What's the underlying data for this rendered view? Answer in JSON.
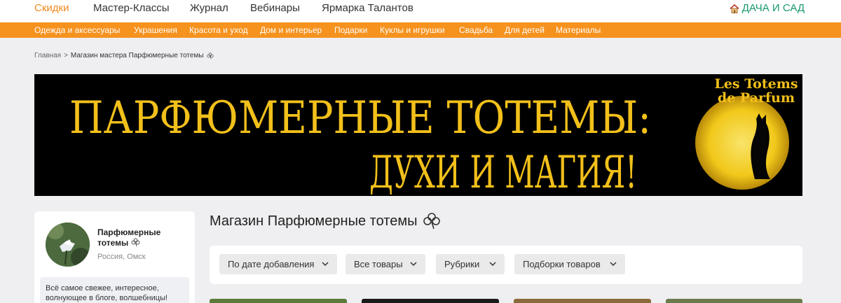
{
  "topnav": {
    "items": [
      "Скидки",
      "Мастер-Классы",
      "Журнал",
      "Вебинары",
      "Ярмарка Талантов"
    ],
    "right_link": "ДАЧА И САД",
    "active_color": "#f0891e",
    "right_color": "#1a9a6b"
  },
  "categories": [
    "Одежда и аксессуары",
    "Украшения",
    "Красота и уход",
    "Дом и интерьер",
    "Подарки",
    "Куклы и игрушки",
    "Свадьба",
    "Для детей",
    "Материалы"
  ],
  "breadcrumb": {
    "home": "Главная",
    "separator": ">",
    "current": "Магазин мастера Парфюмерные тотемы"
  },
  "banner": {
    "line1": "ПАРФЮМЕРНЫЕ ТОТЕМЫ:",
    "line2": "ДУХИ И МАГИЯ!",
    "logo_line1": "Les Totems",
    "logo_line2": "de Parfum"
  },
  "profile": {
    "name": "Парфюмерные тотемы",
    "location": "Россия, Омск",
    "bio": "Всё самое свежее, интересное, волнующее в блоге, волшебницы!"
  },
  "store": {
    "title": "Магазин Парфюмерные тотемы"
  },
  "filters": [
    "По дате добавления",
    "Все товары",
    "Рубрики",
    "Подборки товаров"
  ],
  "colors": {
    "category_bar": "#f6921e",
    "banner_text": "#f2c01a",
    "background": "#efeef0"
  }
}
